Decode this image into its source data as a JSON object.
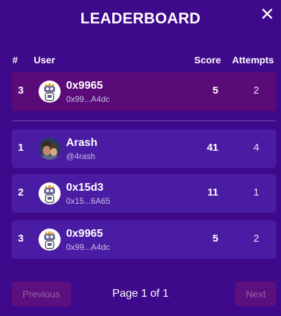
{
  "title": "LEADERBOARD",
  "close_icon": "close-icon",
  "columns": {
    "rank": "#",
    "user": "User",
    "score": "Score",
    "attempts": "Attempts"
  },
  "current_user": {
    "rank": "3",
    "name": "0x9965",
    "handle": "0x99...A4dc",
    "score": "5",
    "attempts": "2",
    "avatar": "robot-avatar"
  },
  "rows": [
    {
      "rank": "1",
      "name": "Arash",
      "handle": "@4rash",
      "score": "41",
      "attempts": "4",
      "avatar": "photo-avatar"
    },
    {
      "rank": "2",
      "name": "0x15d3",
      "handle": "0x15...6A65",
      "score": "11",
      "attempts": "1",
      "avatar": "robot-avatar"
    },
    {
      "rank": "3",
      "name": "0x9965",
      "handle": "0x99...A4dc",
      "score": "5",
      "attempts": "2",
      "avatar": "robot-avatar"
    }
  ],
  "pagination": {
    "previous": "Previous",
    "page_info": "Page 1 of 1",
    "next": "Next"
  },
  "colors": {
    "background": "#3e0a8b",
    "row": "#4a1ca3",
    "current_row": "#5a0b78",
    "button": "#5c1080",
    "button_text": "#93649d"
  }
}
